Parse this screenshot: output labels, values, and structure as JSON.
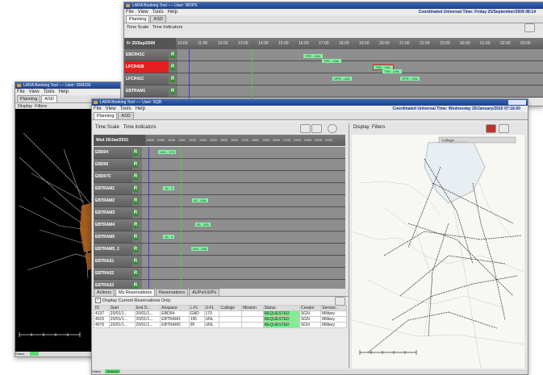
{
  "back_window": {
    "title": "LARA Booking Tool ---- User: WDPS",
    "menu": [
      "File",
      "View",
      "Tools",
      "Help"
    ],
    "utc": "Coordinated Universal Time: Friday 25/September/2009  08:14",
    "tabs": [
      "Planning",
      "ASD"
    ],
    "toolbar": [
      "Time Scale",
      "Time Indicators"
    ],
    "date": "Fr 25/Sep/2009",
    "ticks": [
      "10:00",
      "11:00",
      "12:00",
      "13:00",
      "14:00",
      "15:00",
      "16:00",
      "17:00",
      "18:00",
      "19:00",
      "20:00",
      "21:00",
      "22:00",
      "23:00",
      "00:00",
      "01:00",
      "02:00",
      "03:00"
    ],
    "rows": [
      "EBCR41C",
      "LFCR41B",
      "LFCR41C",
      "EBTRAM1"
    ],
    "reservations": [
      "TPR - UNL",
      "TPR - UNL",
      "TSR - UNL",
      "TSR - UNL",
      "OPR - UNL",
      "OPR - UNL"
    ]
  },
  "left_window": {
    "title": "LARA Booking Tool ---- User: SWEDE",
    "menu": [
      "File",
      "View",
      "Tools",
      "Help"
    ],
    "tabs": [
      "Planning",
      "ASD"
    ],
    "toolbar": [
      "Display",
      "Filters"
    ],
    "status": "Status"
  },
  "front_window": {
    "title": "LARA Booking Tool ---- User: SQR",
    "menu": [
      "File",
      "View",
      "Tools",
      "Help"
    ],
    "utc": "Coordinated Universal Time: Wednesday 20/January/2010  07:16:00",
    "tabs": [
      "Planning",
      "ASD"
    ],
    "toolbar": [
      "Time Scale",
      "Time Indicators"
    ],
    "date": "Wed 20/Jan/2010",
    "ticks": [
      "0800",
      "0900",
      "1000",
      "1100",
      "1200",
      "1300",
      "1400",
      "1500",
      "1600",
      "1700",
      "1800",
      "1900",
      "2000",
      "2100",
      "2200",
      "2300",
      "0000",
      "0100"
    ],
    "rows": [
      {
        "name": "EBD04",
        "res": "UNL - 170"
      },
      {
        "name": "EBD06",
        "res": ""
      },
      {
        "name": "EBD07C",
        "res": ""
      },
      {
        "name": "EBTRAM1",
        "res": "16 - 0"
      },
      {
        "name": "EBTRAM2",
        "res": "95 - UNL"
      },
      {
        "name": "EBTRAM3",
        "res": ""
      },
      {
        "name": "EBTRAM4",
        "res": "95 - 295"
      },
      {
        "name": "EBTRAM5",
        "res": "16 - 0"
      },
      {
        "name": "EBTRAM5_2",
        "res": "095 - 295"
      },
      {
        "name": "EBTRAS1",
        "res": ""
      },
      {
        "name": "EBTRAS2",
        "res": ""
      },
      {
        "name": "EBTRAS3",
        "res": ""
      }
    ],
    "bottom_tabs": [
      "Actions",
      "My Reservations",
      "Reservations",
      "AUPs/UUPs"
    ],
    "display_current_label": "Display Current Reservations Only",
    "table_headers": [
      "ID",
      "Start",
      "End D...",
      "Airspace",
      "L-FL",
      "U-FL",
      "Callsign",
      "Mission",
      "Status",
      "Creator",
      "Service..."
    ],
    "table_rows": [
      [
        "4137",
        "20/01/1...",
        "20/01/1...",
        "EBD04",
        "GND",
        "170",
        "",
        "",
        "REQUESTED",
        "SGN",
        "Military"
      ],
      [
        "4015",
        "20/01/1...",
        "20/01/1...",
        "EBTRAM1",
        "195",
        "UNL",
        "",
        "",
        "REQUESTED",
        "SGN",
        "Military"
      ],
      [
        "4076",
        "20/01/1...",
        "20/01/1...",
        "EBTRAM2",
        "95",
        "UNL",
        "",
        "",
        "REQUESTED",
        "SGN",
        "Military"
      ]
    ],
    "map_toolbar": [
      "Display",
      "Filters"
    ],
    "map_callout": "Callsign ... ... ...",
    "status": "Status",
    "status_ok": "Network"
  },
  "colors": {
    "titlebar": "#1d3f86",
    "requested": "#7cf08e",
    "reservation": "#86f0a6",
    "alert_row": "#e31f1f",
    "now_line": "#3b3bd8"
  }
}
